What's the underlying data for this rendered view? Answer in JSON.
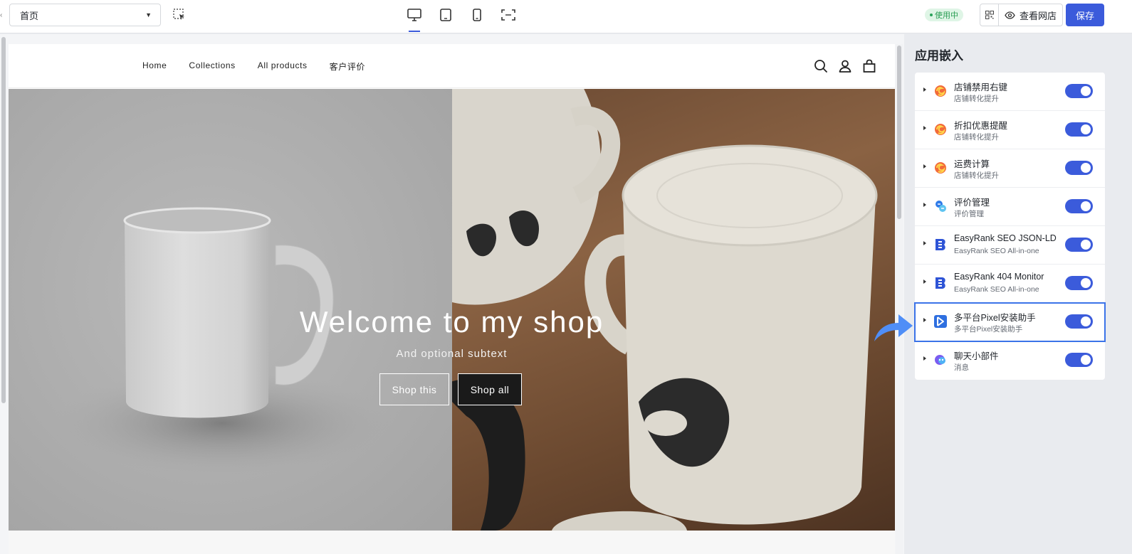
{
  "topbar": {
    "left_edge": "‹",
    "page_select": {
      "value": "首页"
    },
    "status_badge": "使用中",
    "view_store_label": "查看网店",
    "save_label": "保存"
  },
  "shop": {
    "nav": [
      "Home",
      "Collections",
      "All products",
      "客户评价"
    ],
    "hero": {
      "title": "Welcome to my shop",
      "subtitle": "And optional subtext",
      "button_primary": "Shop this",
      "button_secondary": "Shop all"
    }
  },
  "panel": {
    "title": "应用嵌入",
    "embeds": [
      {
        "name": "店铺禁用右键",
        "sub": "店铺转化提升",
        "enabled": true,
        "icon": "swirl-app-icon"
      },
      {
        "name": "折扣优惠提醒",
        "sub": "店铺转化提升",
        "enabled": true,
        "icon": "swirl-app-icon"
      },
      {
        "name": "运费计算",
        "sub": "店铺转化提升",
        "enabled": true,
        "icon": "swirl-app-icon"
      },
      {
        "name": "评价管理",
        "sub": "评价管理",
        "enabled": true,
        "icon": "review-app-icon"
      },
      {
        "name": "EasyRank SEO JSON-LD",
        "sub": "EasyRank SEO All-in-one",
        "enabled": true,
        "icon": "easyrank-app-icon"
      },
      {
        "name": "EasyRank 404 Monitor",
        "sub": "EasyRank SEO All-in-one",
        "enabled": true,
        "icon": "easyrank-app-icon"
      },
      {
        "name": "多平台Pixel安装助手",
        "sub": "多平台Pixel安装助手",
        "enabled": true,
        "icon": "pixel-app-icon"
      },
      {
        "name": "聊天小部件",
        "sub": "消息",
        "enabled": true,
        "icon": "chat-app-icon"
      }
    ]
  },
  "colors": {
    "accent": "#3b5bdb",
    "badge_bg": "#dff5e6",
    "badge_text": "#2a9d54",
    "highlight": "#3b73e8"
  }
}
